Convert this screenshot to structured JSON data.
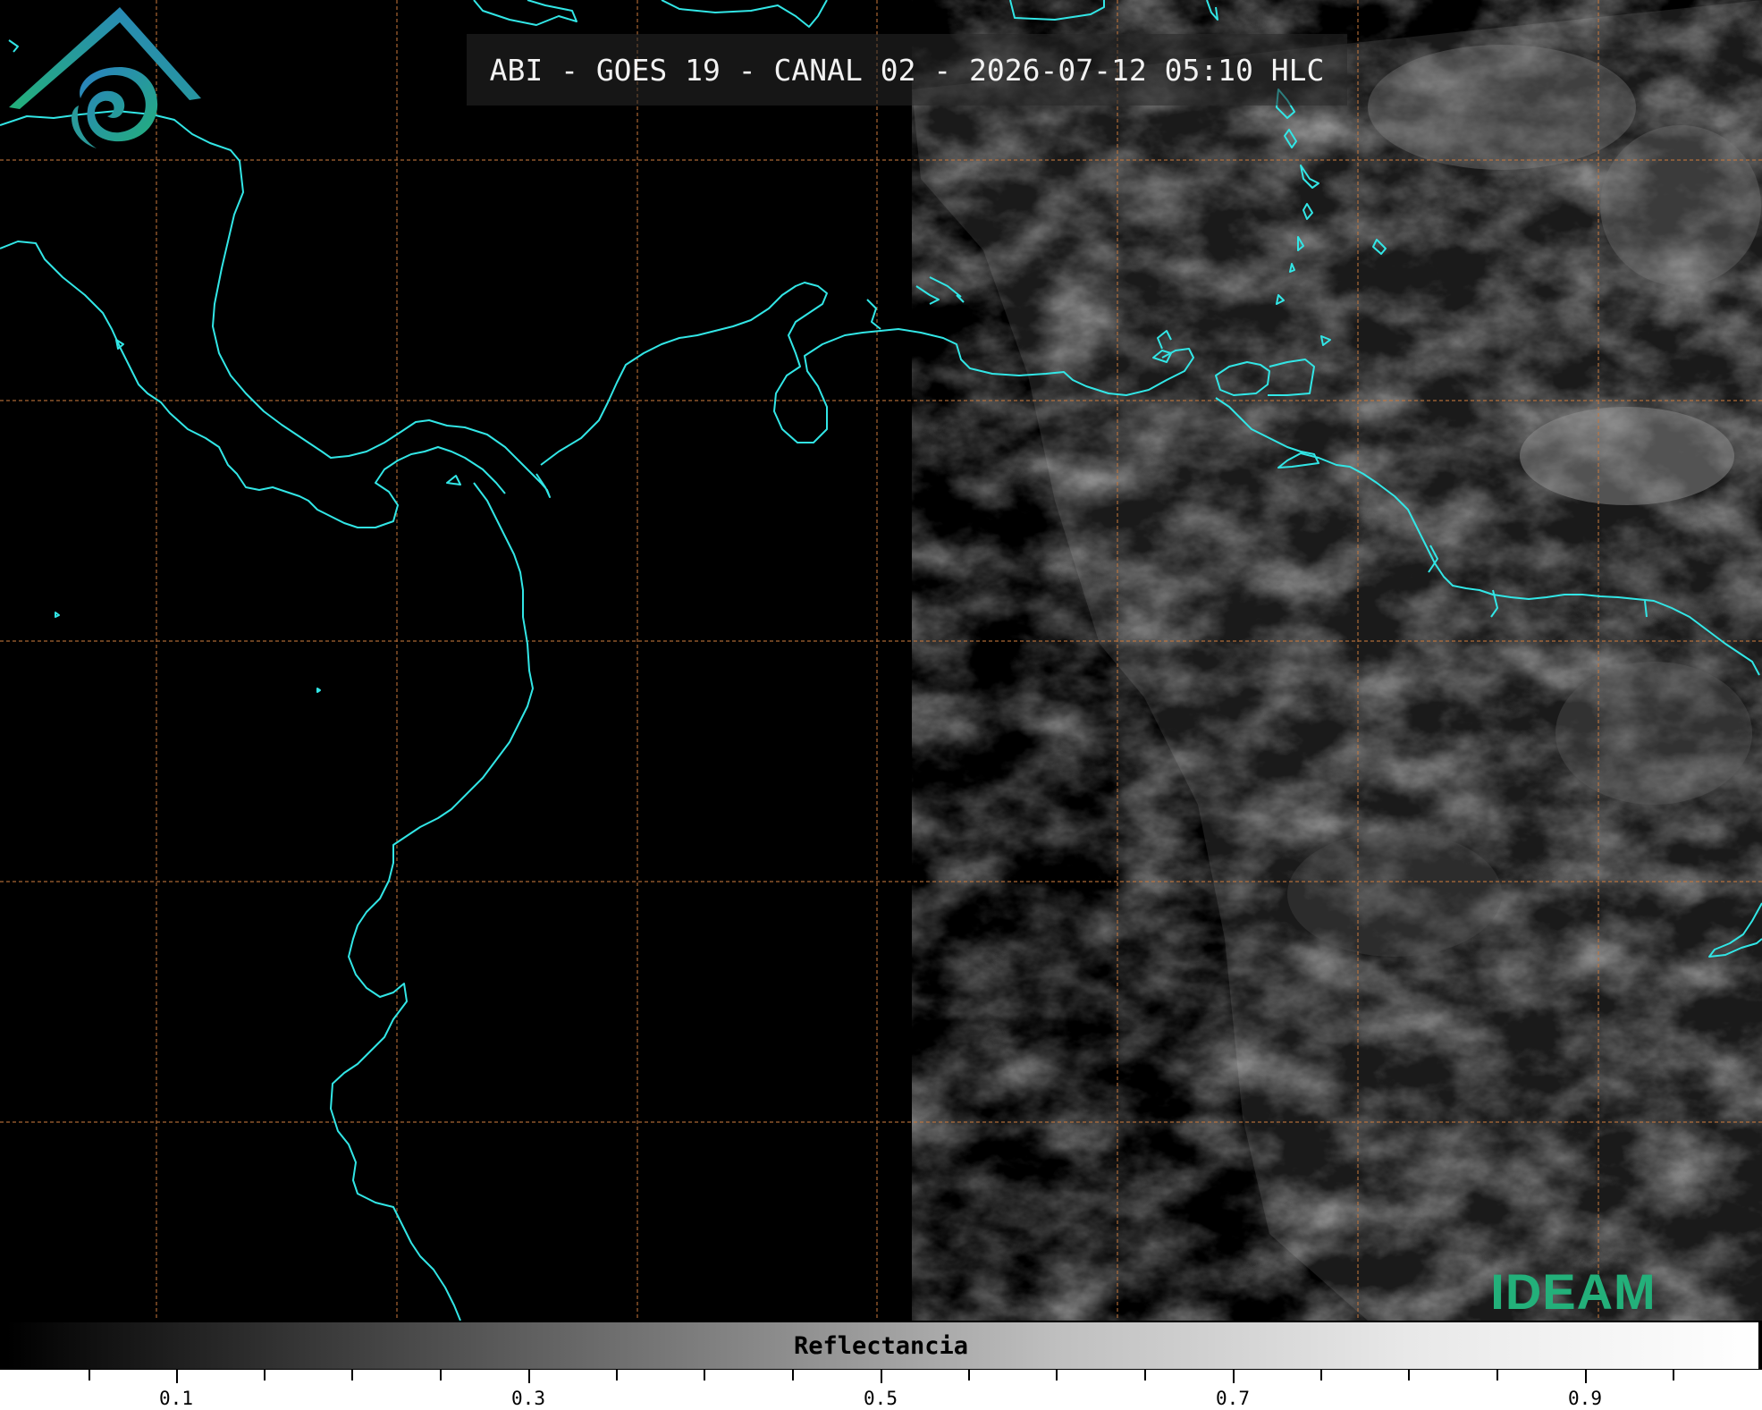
{
  "title": "ABI - GOES 19 - CANAL 02 - 2026-07-12 05:10 HLC",
  "colorbar": {
    "label": "Reflectancia",
    "ticks": [
      "0.1",
      "0.3",
      "0.5",
      "0.7",
      "0.9"
    ]
  },
  "logo": {
    "text": "IDEAM"
  },
  "colors": {
    "coastline": "#32e6e6",
    "grid": "#c8783c",
    "logo_green": "#23b07a",
    "logo_blue": "#2a7fc4"
  },
  "icons": [
    "ideam-logo-icon"
  ]
}
